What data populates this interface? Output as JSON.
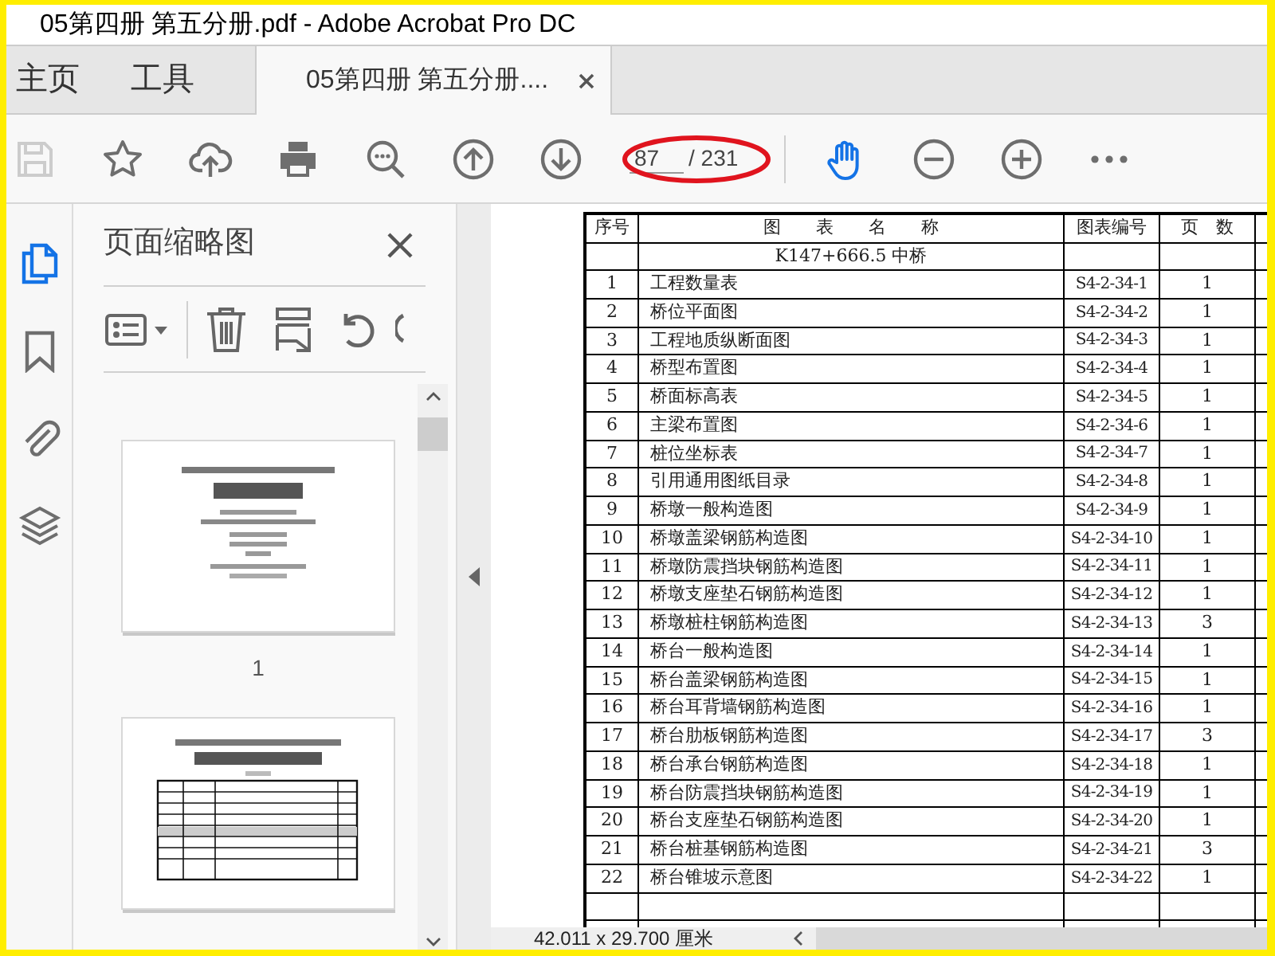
{
  "window": {
    "title": "05第四册 第五分册.pdf - Adobe Acrobat Pro DC"
  },
  "tabs": [
    {
      "label": "主页",
      "kind": "nav",
      "selected": false
    },
    {
      "label": "工具",
      "kind": "nav",
      "selected": false
    },
    {
      "label": "05第四册 第五分册....",
      "kind": "document",
      "selected": true
    }
  ],
  "toolbar": {
    "tools_left": [
      {
        "kind": "save",
        "disabled": true,
        "selected": false
      },
      {
        "kind": "star",
        "disabled": false,
        "selected": false
      },
      {
        "kind": "upload",
        "disabled": false,
        "selected": false
      },
      {
        "kind": "print",
        "disabled": false,
        "selected": false
      },
      {
        "kind": "find",
        "disabled": false,
        "selected": false
      },
      {
        "kind": "up",
        "disabled": false,
        "selected": false
      },
      {
        "kind": "down",
        "disabled": false,
        "selected": false
      }
    ],
    "page_number": "87",
    "page_count": "/ 231",
    "tools_right": [
      {
        "kind": "hand",
        "disabled": false,
        "selected": true
      },
      {
        "kind": "zoom_out",
        "disabled": false,
        "selected": false
      },
      {
        "kind": "zoom_in",
        "disabled": false,
        "selected": false
      },
      {
        "kind": "more",
        "disabled": false,
        "selected": false
      }
    ]
  },
  "rail": [
    {
      "kind": "pages",
      "selected": true
    },
    {
      "kind": "bookmarks",
      "selected": false
    },
    {
      "kind": "attachments",
      "selected": false
    },
    {
      "kind": "layers",
      "selected": false
    }
  ],
  "thumbnails_panel": {
    "title": "页面缩略图",
    "thumbnails": [
      {
        "label": "1",
        "kind": "cover"
      },
      {
        "kind": "contents"
      }
    ]
  },
  "document": {
    "table": {
      "columns": [
        "序号",
        "图　　表　　名　　称",
        "图表编号",
        "页　数"
      ],
      "section": "K147+666.5 中桥",
      "rows": [
        [
          "1",
          "工程数量表",
          "S4-2-34-1",
          "1"
        ],
        [
          "2",
          "桥位平面图",
          "S4-2-34-2",
          "1"
        ],
        [
          "3",
          "工程地质纵断面图",
          "S4-2-34-3",
          "1"
        ],
        [
          "4",
          "桥型布置图",
          "S4-2-34-4",
          "1"
        ],
        [
          "5",
          "桥面标高表",
          "S4-2-34-5",
          "1"
        ],
        [
          "6",
          "主梁布置图",
          "S4-2-34-6",
          "1"
        ],
        [
          "7",
          "桩位坐标表",
          "S4-2-34-7",
          "1"
        ],
        [
          "8",
          "引用通用图纸目录",
          "S4-2-34-8",
          "1"
        ],
        [
          "9",
          "桥墩一般构造图",
          "S4-2-34-9",
          "1"
        ],
        [
          "10",
          "桥墩盖梁钢筋构造图",
          "S4-2-34-10",
          "1"
        ],
        [
          "11",
          "桥墩防震挡块钢筋构造图",
          "S4-2-34-11",
          "1"
        ],
        [
          "12",
          "桥墩支座垫石钢筋构造图",
          "S4-2-34-12",
          "1"
        ],
        [
          "13",
          "桥墩桩柱钢筋构造图",
          "S4-2-34-13",
          "3"
        ],
        [
          "14",
          "桥台一般构造图",
          "S4-2-34-14",
          "1"
        ],
        [
          "15",
          "桥台盖梁钢筋构造图",
          "S4-2-34-15",
          "1"
        ],
        [
          "16",
          "桥台耳背墙钢筋构造图",
          "S4-2-34-16",
          "1"
        ],
        [
          "17",
          "桥台肋板钢筋构造图",
          "S4-2-34-17",
          "3"
        ],
        [
          "18",
          "桥台承台钢筋构造图",
          "S4-2-34-18",
          "1"
        ],
        [
          "19",
          "桥台防震挡块钢筋构造图",
          "S4-2-34-19",
          "1"
        ],
        [
          "20",
          "桥台支座垫石钢筋构造图",
          "S4-2-34-20",
          "1"
        ],
        [
          "21",
          "桥台桩基钢筋构造图",
          "S4-2-34-21",
          "3"
        ],
        [
          "22",
          "桥台锥坡示意图",
          "S4-2-34-22",
          "1"
        ]
      ]
    }
  },
  "status_bar": {
    "page_size": "42.011 x 29.700 厘米"
  }
}
